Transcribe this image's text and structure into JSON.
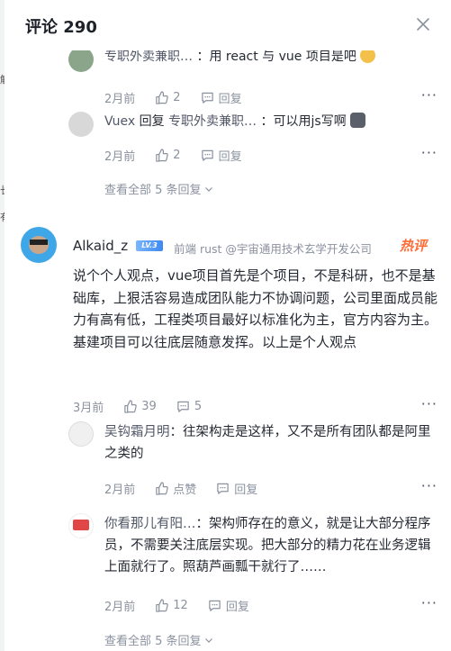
{
  "header": {
    "title": "评论 290"
  },
  "left_strip": [
    "解",
    "长",
    "有"
  ],
  "replies_top": [
    {
      "name": "专职外卖兼职…",
      "reply_to": "",
      "text": "：用 react 与 vue 项目是吧",
      "date": "2月前",
      "likes": "2",
      "reply_label": "回复"
    },
    {
      "name": "Vuex",
      "reply_word": "回复",
      "reply_to": "专职外卖兼职…",
      "text": "：可以用js写啊",
      "date": "2月前",
      "likes": "2",
      "reply_label": "回复"
    }
  ],
  "view_all_1": "查看全部 5 条回复",
  "main": {
    "name": "Alkaid_z",
    "level": "LV.3",
    "job": "前端 rust @宇宙通用技术玄学开发公司",
    "hot_badge": "热评",
    "text": "说个个人观点，vue项目首先是个项目，不是科研，也不是基础库，上狠活容易造成团队能力不协调问题，公司里面成员能力有高有低，工程类项目最好以标准化为主，官方内容为主。基建项目可以往底层随意发挥。以上是个人观点",
    "date": "3月前",
    "likes": "39",
    "comments": "5"
  },
  "sub_replies": [
    {
      "name": "吴钩霜月明",
      "text": "：往架构走是这样，又不是所有团队都是阿里之类的",
      "date": "2月前",
      "likes": "点赞",
      "reply_label": "回复"
    },
    {
      "name": "你看那儿有阳…",
      "text": "：架构师存在的意义，就是让大部分程序员，不需要关注底层实现。把大部分的精力花在业务逻辑上面就行了。照葫芦画瓢干就行了……",
      "date": "2月前",
      "likes": "12",
      "reply_label": "回复"
    }
  ],
  "view_all_2": "查看全部 5 条回复",
  "colors": {
    "accent": "#1e80ff",
    "hot": "#ff6c35",
    "muted": "#8a919f"
  }
}
